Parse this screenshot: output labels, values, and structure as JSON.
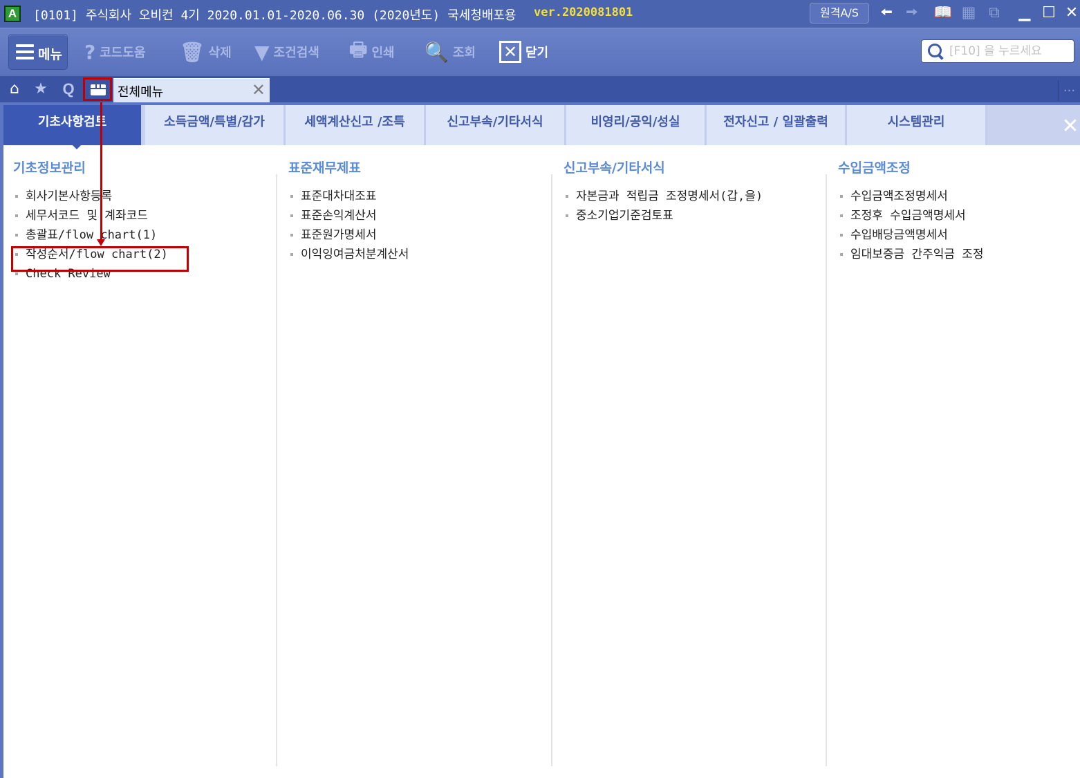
{
  "titlebar": {
    "logo": "A",
    "title": "[0101] 주식회사 오비컨  4기 2020.01.01-2020.06.30 (2020년도) 국세청배포용",
    "version": "ver.2020081801",
    "remote_as": "원격A/S",
    "icons": [
      "back-arrow-icon",
      "forward-arrow-icon",
      "book-icon",
      "grid-icon",
      "window-icon",
      "minimize-icon",
      "maximize-icon",
      "close-icon"
    ]
  },
  "toolbar": {
    "menu": "메뉴",
    "code_help": "코드도움",
    "delete": "삭제",
    "filter_search": "조건검색",
    "print": "인쇄",
    "inquiry": "조회",
    "close": "닫기",
    "search_placeholder": "[F10] 을 누르세요"
  },
  "tabstrip": {
    "open_tab": "전체메뉴",
    "more": "..."
  },
  "categories": [
    "기초사항검토",
    "소득금액/특별/감가",
    "세액계산신고 /조특",
    "신고부속/기타서식",
    "비영리/공익/성실",
    "전자신고 / 일괄출력",
    "시스템관리"
  ],
  "columns": [
    {
      "title": "기초정보관리",
      "items": [
        "회사기본사항등록",
        "세무서코드 및 계좌코드",
        "총괄표/flow chart(1)",
        "작성순서/flow chart(2)",
        "Check Review"
      ]
    },
    {
      "title": "표준재무제표",
      "items": [
        "표준대차대조표",
        "표준손익계산서",
        "표준원가명세서",
        "이익잉여금처분계산서"
      ]
    },
    {
      "title": "신고부속/기타서식",
      "items": [
        "자본금과 적립금 조정명세서(갑,을)",
        "중소기업기준검토표"
      ]
    },
    {
      "title": "수입금액조정",
      "items": [
        "수입금액조정명세서",
        "조정후 수입금액명세서",
        "수입배당금액명세서",
        "임대보증금 간주익금 조정"
      ]
    }
  ],
  "colors": {
    "titlebar": "#4a64b0",
    "toolbar": "#6a82c8",
    "active_category": "#3b58b5",
    "category_tab": "#dde5f8",
    "column_title": "#5b8bd6",
    "annotation": "#c00000",
    "version_text": "#f3e03a"
  }
}
